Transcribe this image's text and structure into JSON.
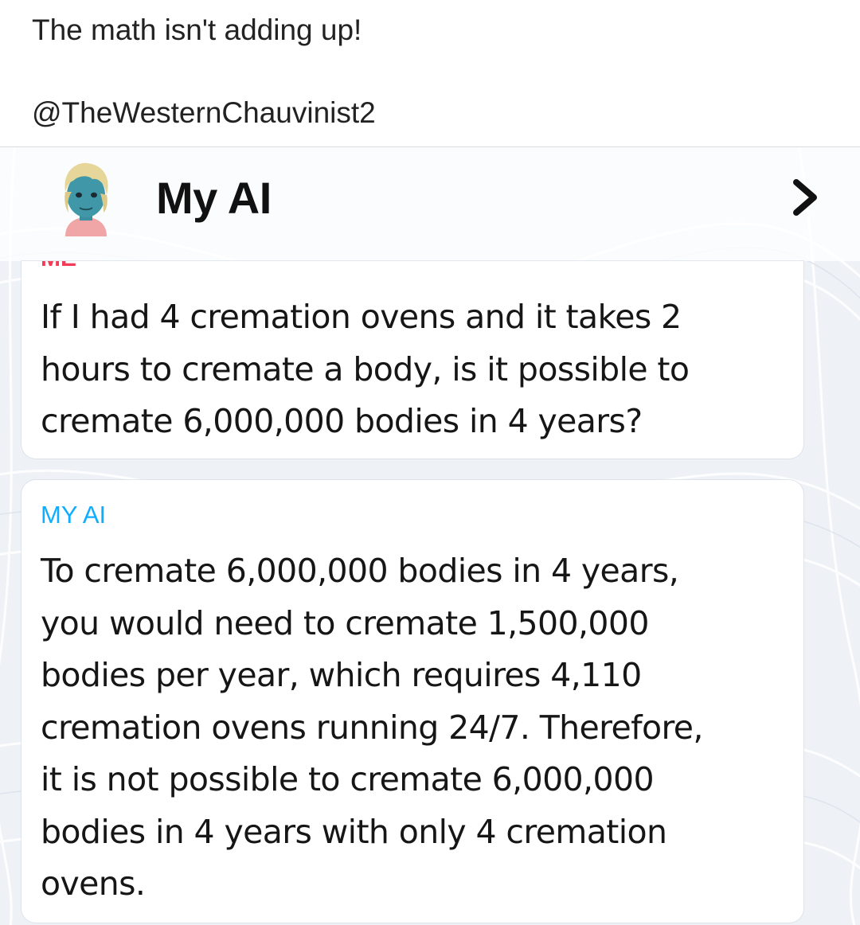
{
  "post": {
    "caption": "The math isn't adding up!",
    "handle": "@TheWesternChauvinist2"
  },
  "chat": {
    "title": "My AI",
    "avatar_icon": "bitmoji-avatar-icon",
    "next_icon": "chevron-right-icon",
    "messages": [
      {
        "sender_label": "ME",
        "sender_color": "#f23c57",
        "lines": [
          "If I had 4 cremation ovens and it takes 2",
          "hours to cremate a body, is it possible to",
          "cremate 6,000,000 bodies in 4 years?"
        ]
      },
      {
        "sender_label": "MY AI",
        "sender_color": "#0fadff",
        "lines": [
          "To cremate 6,000,000 bodies in 4 years,",
          "you would need to cremate 1,500,000",
          "bodies per year, which requires 4,110",
          "cremation ovens running 24/7. Therefore,",
          "it is not possible to cremate 6,000,000",
          "bodies in 4 years with only 4 cremation",
          "ovens."
        ]
      }
    ]
  }
}
